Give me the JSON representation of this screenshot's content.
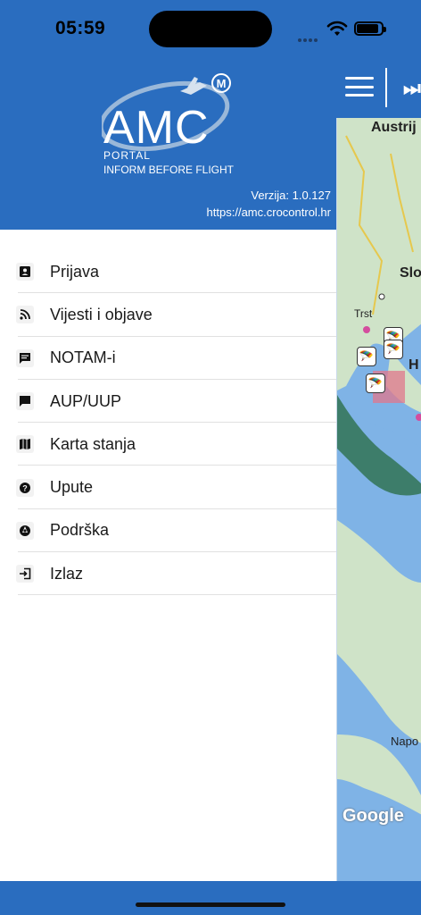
{
  "status": {
    "time": "05:59"
  },
  "app": {
    "logo_main": "AMC",
    "logo_badge": "M",
    "logo_portal": "PORTAL",
    "logo_tagline": "INFORM BEFORE FLIGHT",
    "version": "Verzija: 1.0.127",
    "url": "https://amc.crocontrol.hr"
  },
  "menu": {
    "items": [
      {
        "label": "Prijava",
        "icon": "id-card-icon"
      },
      {
        "label": "Vijesti i objave",
        "icon": "rss-icon"
      },
      {
        "label": "NOTAM-i",
        "icon": "message-text-icon"
      },
      {
        "label": "AUP/UUP",
        "icon": "chat-icon"
      },
      {
        "label": "Karta stanja",
        "icon": "map-icon"
      },
      {
        "label": "Upute",
        "icon": "help-circle-icon"
      },
      {
        "label": "Podrška",
        "icon": "support-icon"
      },
      {
        "label": "Izlaz",
        "icon": "exit-icon"
      }
    ]
  },
  "map": {
    "labels": [
      "Austrij",
      "Slo",
      "Trst",
      "H",
      "Napo"
    ],
    "provider": "Google"
  },
  "colors": {
    "brand": "#2a6dbf",
    "map_water": "#7fb3e6",
    "map_land": "#cfe3c8"
  }
}
